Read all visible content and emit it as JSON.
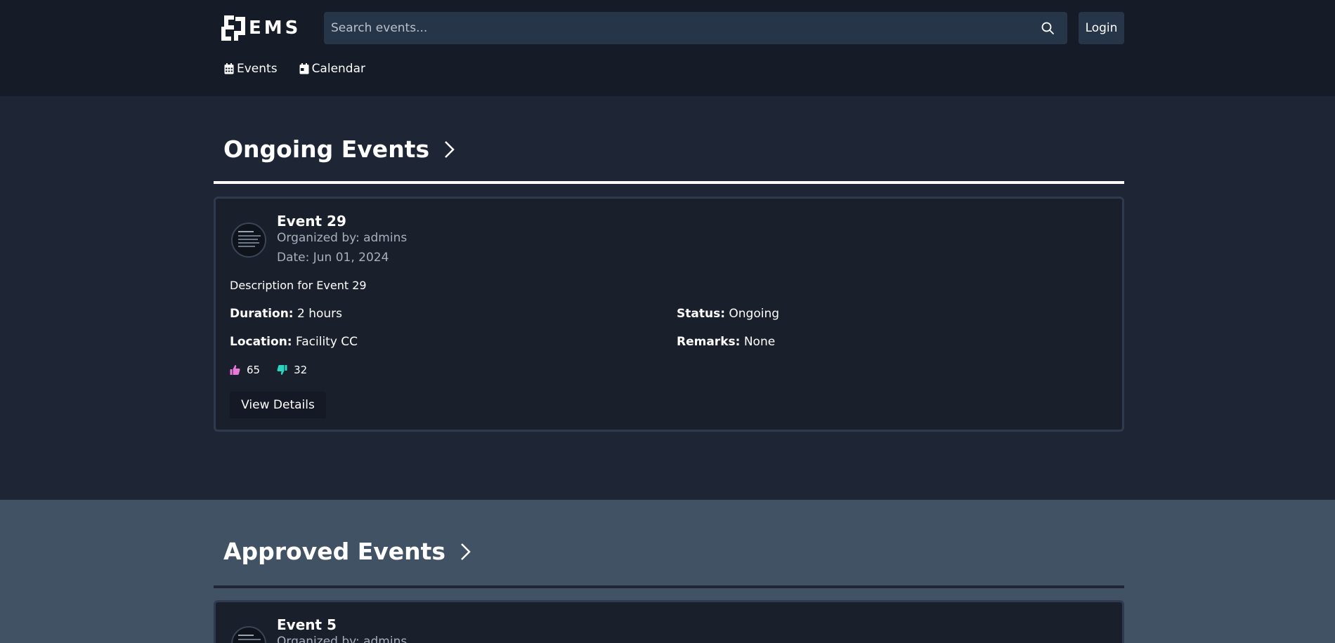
{
  "header": {
    "logo_text": "EMS",
    "search": {
      "placeholder": "Search events..."
    },
    "login_label": "Login"
  },
  "nav": {
    "items": [
      {
        "label": "Events",
        "icon": "calendar-grid-icon"
      },
      {
        "label": "Calendar",
        "icon": "calendar-day-icon"
      }
    ]
  },
  "sections": [
    {
      "title": "Ongoing Events",
      "event": {
        "title": "Event 29",
        "organizer": "Organized by: admins",
        "date": "Date: Jun 01, 2024",
        "description": "Description for Event 29",
        "duration_label": "Duration:",
        "duration": "2 hours",
        "status_label": "Status:",
        "status": "Ongoing",
        "location_label": "Location:",
        "location": "Facility CC",
        "remarks_label": "Remarks:",
        "remarks": "None",
        "likes": "65",
        "dislikes": "32",
        "view_label": "View Details"
      }
    },
    {
      "title": "Approved Events",
      "event": {
        "title": "Event 5",
        "organizer": "Organized by: admins"
      }
    }
  ],
  "colors": {
    "header_bg": "#151b27",
    "page_bg": "#1e2535",
    "approved_bg": "#415265",
    "card_bg": "#1a1f2c",
    "like": "#e879d9",
    "dislike": "#2dd4bf"
  }
}
